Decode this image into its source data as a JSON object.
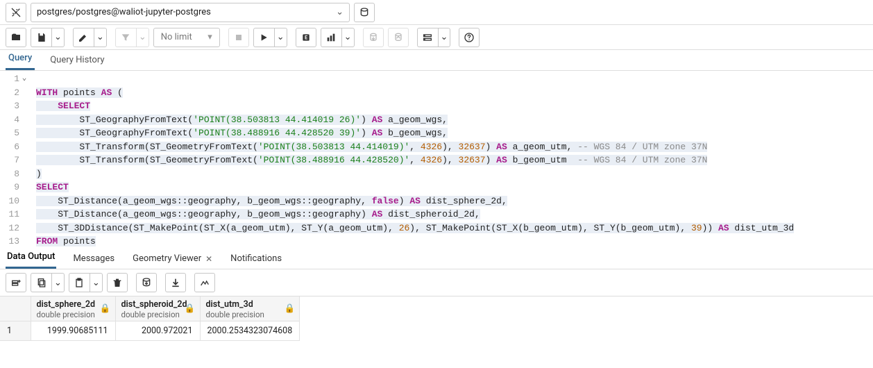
{
  "top": {
    "connection": "postgres/postgres@waliot-jupyter-postgres",
    "nolimit": "No limit"
  },
  "tabs": {
    "query": "Query",
    "history": "Query History"
  },
  "code": {
    "l1_with": "WITH",
    "l1_points": " points ",
    "l1_as": "AS",
    "l1_paren": " (",
    "l2_select": "SELECT",
    "l3_fn": "        ST_GeographyFromText(",
    "l3_str": "'POINT(38.503813 44.414019 26)'",
    "l3_rest": ") ",
    "l3_as": "AS",
    "l3_alias": " a_geom_wgs,",
    "l4_fn": "        ST_GeographyFromText(",
    "l4_str": "'POINT(38.488916 44.428520 39)'",
    "l4_rest": ") ",
    "l4_as": "AS",
    "l4_alias": " b_geom_wgs,",
    "l5_fn": "        ST_Transform(ST_GeometryFromText(",
    "l5_str": "'POINT(38.503813 44.414019)'",
    "l5_c1": ", ",
    "l5_n1": "4326",
    "l5_c2": "), ",
    "l5_n2": "32637",
    "l5_c3": ") ",
    "l5_as": "AS",
    "l5_alias": " a_geom_utm, ",
    "l5_cmt": "-- WGS 84 / UTM zone 37N",
    "l6_fn": "        ST_Transform(ST_GeometryFromText(",
    "l6_str": "'POINT(38.488916 44.428520)'",
    "l6_c1": ", ",
    "l6_n1": "4326",
    "l6_c2": "), ",
    "l6_n2": "32637",
    "l6_c3": ") ",
    "l6_as": "AS",
    "l6_alias": " b_geom_utm  ",
    "l6_cmt": "-- WGS 84 / UTM zone 37N",
    "l7": ")",
    "l8": "SELECT",
    "l9a": "    ST_Distance(a_geom_wgs",
    "l9b": "::",
    "l9c": "geography, b_geom_wgs",
    "l9d": "::",
    "l9e": "geography, ",
    "l9f": "false",
    "l9g": ") ",
    "l9as": "AS",
    "l9h": " dist_sphere_2d,",
    "l10a": "    ST_Distance(a_geom_wgs",
    "l10b": "::",
    "l10c": "geography, b_geom_wgs",
    "l10d": "::",
    "l10e": "geography) ",
    "l10as": "AS",
    "l10f": " dist_spheroid_2d,",
    "l11a": "    ST_3DDistance(ST_MakePoint(ST_X(a_geom_utm), ST_Y(a_geom_utm), ",
    "l11n1": "26",
    "l11b": "), ST_MakePoint(ST_X(b_geom_utm), ST_Y(b_geom_utm), ",
    "l11n2": "39",
    "l11c": ")) ",
    "l11as": "AS",
    "l11d": " dist_utm_3d",
    "l12a": "FROM",
    "l12b": " points"
  },
  "rtabs": {
    "data": "Data Output",
    "msg": "Messages",
    "geom": "Geometry Viewer",
    "notif": "Notifications"
  },
  "grid": {
    "cols": [
      {
        "name": "dist_sphere_2d",
        "type": "double precision"
      },
      {
        "name": "dist_spheroid_2d",
        "type": "double precision"
      },
      {
        "name": "dist_utm_3d",
        "type": "double precision"
      }
    ],
    "row1": {
      "num": "1",
      "c0": "1999.90685111",
      "c1": "2000.972021",
      "c2": "2000.2534323074608"
    }
  }
}
